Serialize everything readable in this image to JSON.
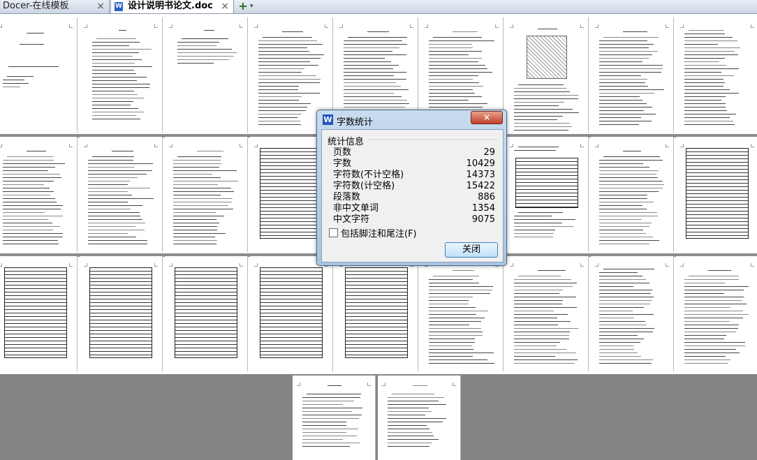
{
  "tabs": [
    {
      "label": "Docer-在线模板",
      "close": "×"
    },
    {
      "label": "设计说明书论文.doc",
      "close": "×",
      "icon": "W"
    }
  ],
  "new_tab": "+",
  "new_tab_menu": "▾",
  "dialog": {
    "title": "字数统计",
    "icon": "W",
    "close": "×",
    "section": "统计信息",
    "stats": [
      {
        "label": "页数",
        "value": "29"
      },
      {
        "label": "字数",
        "value": "10429"
      },
      {
        "label": "字符数(不计空格)",
        "value": "14373"
      },
      {
        "label": "字符数(计空格)",
        "value": "15422"
      },
      {
        "label": "段落数",
        "value": "886"
      },
      {
        "label": "非中文单词",
        "value": "1354"
      },
      {
        "label": "中文字符",
        "value": "9075"
      }
    ],
    "checkbox_label": "包括脚注和尾注(F)",
    "checkbox_checked": false,
    "close_button": "关闭"
  }
}
